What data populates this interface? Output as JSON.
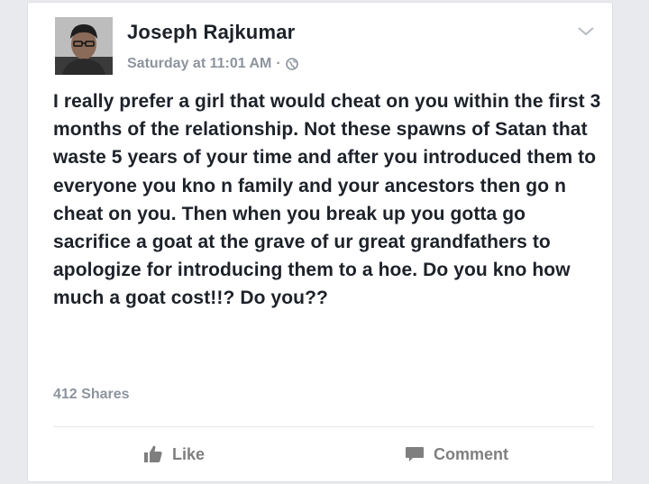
{
  "post": {
    "author": "Joseph Rajkumar",
    "timestamp": "Saturday at 11:01 AM",
    "separator": "·",
    "privacy_icon": "globe-icon",
    "menu_icon": "chevron-down-icon",
    "body": "I really prefer a girl that would cheat on you within the first 3 months of the relationship. Not these spawns of Satan that waste 5 years of your time and after you introduced them to everyone you kno n family and your ancestors then go n cheat on you. Then when you break up you gotta go sacrifice a goat at the grave of ur great grandfathers to apologize for introducing them to a hoe. Do you kno how much a goat cost!!? Do you??",
    "shares": "412 Shares"
  },
  "actions": {
    "like_label": "Like",
    "like_icon": "thumbs-up-icon",
    "comment_label": "Comment",
    "comment_icon": "speech-bubble-icon"
  },
  "colors": {
    "text": "#1d2129",
    "muted": "#8d949e",
    "action": "#7f7f7f",
    "background": "#e9eaee",
    "card": "#ffffff"
  }
}
